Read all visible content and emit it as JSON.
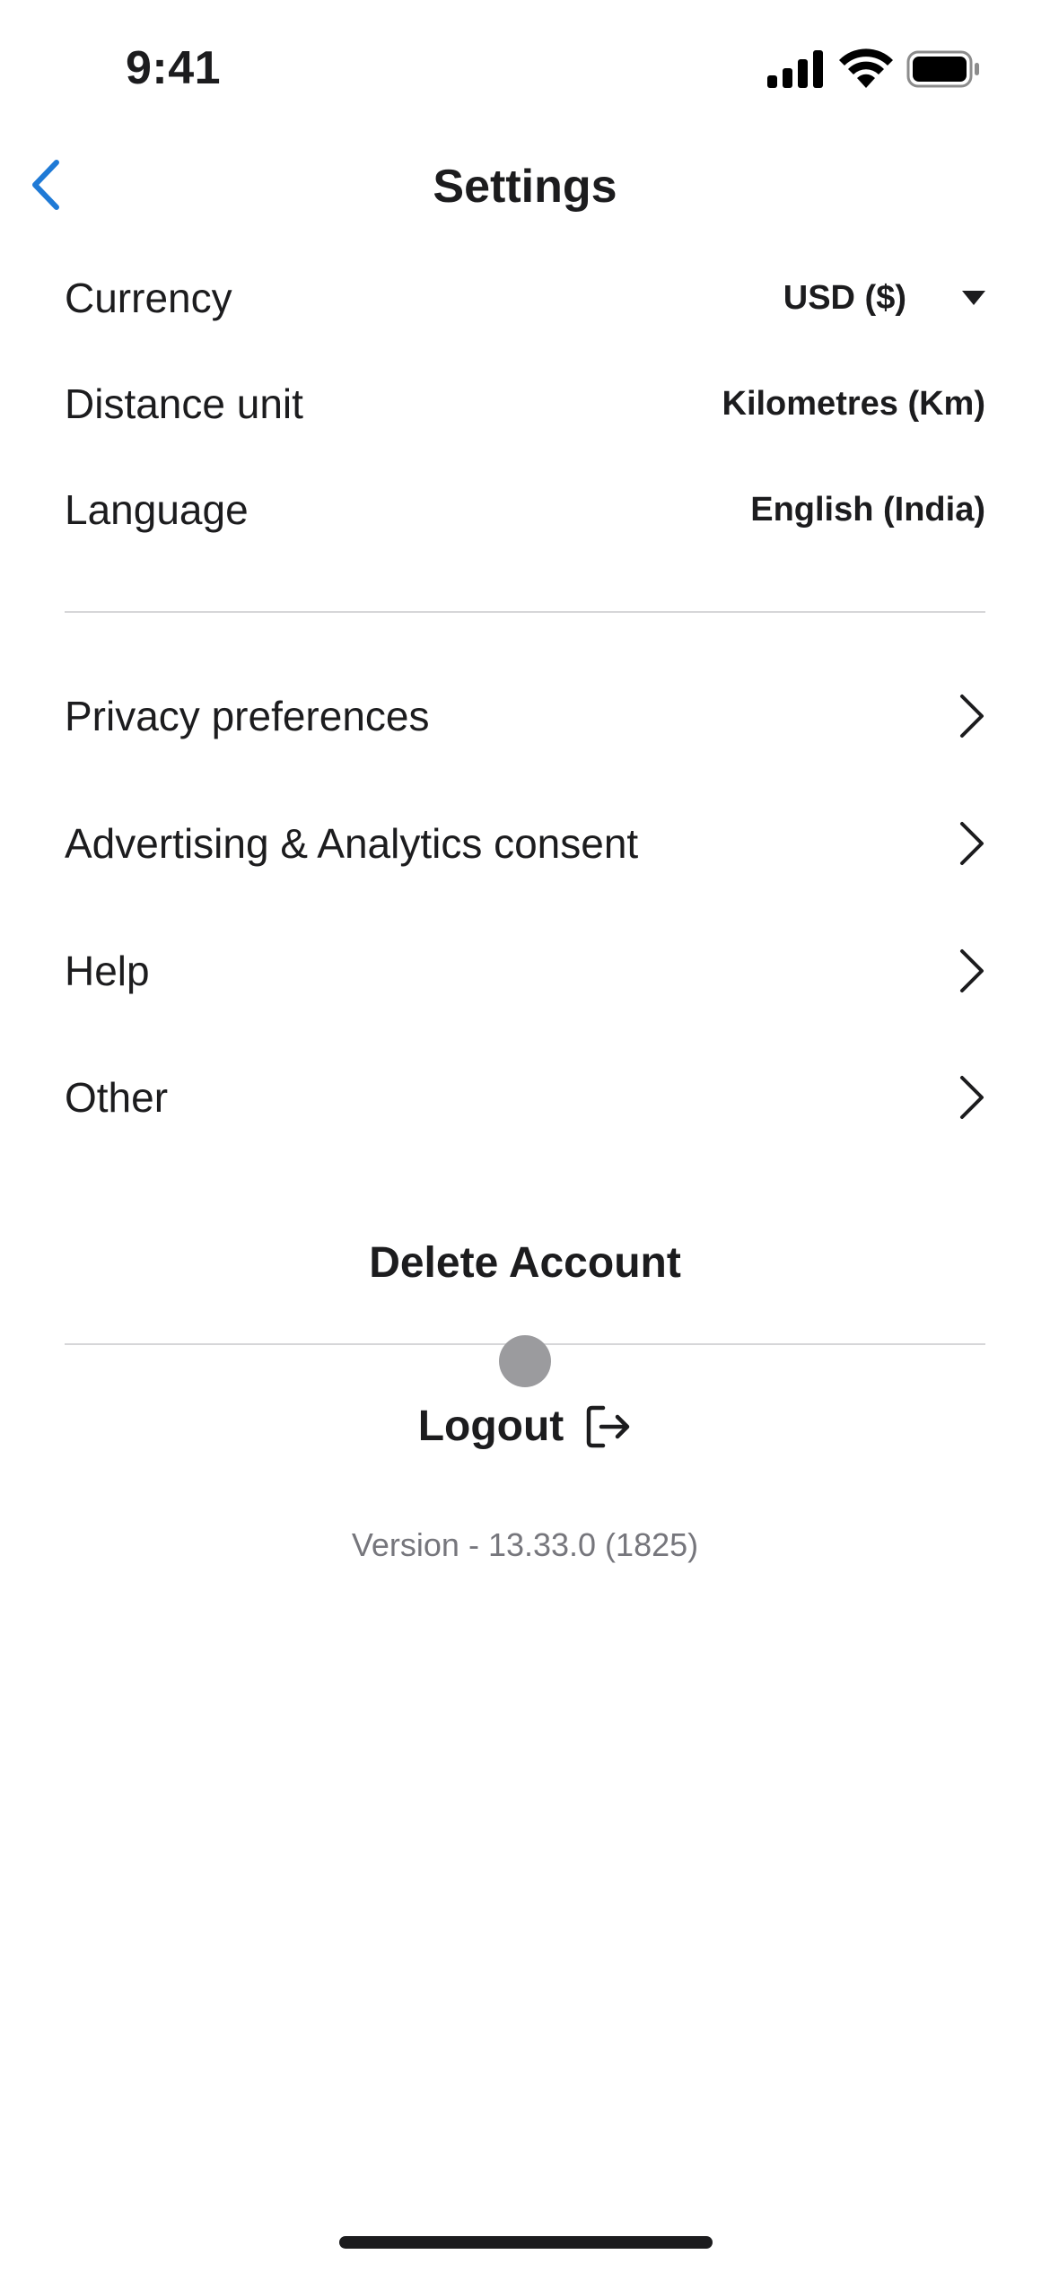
{
  "status_bar": {
    "time": "9:41"
  },
  "header": {
    "title": "Settings",
    "back_icon": "chevron-left-icon",
    "accent_color": "#1f7ad6"
  },
  "preferences": [
    {
      "label": "Currency",
      "value": "USD ($)",
      "has_dropdown": true
    },
    {
      "label": "Distance unit",
      "value": "Kilometres (Km)"
    },
    {
      "label": "Language",
      "value": "English (India)"
    }
  ],
  "menu_items": [
    {
      "label": "Privacy preferences",
      "icon": "chevron-right-icon"
    },
    {
      "label": "Advertising & Analytics consent",
      "icon": "chevron-right-icon"
    },
    {
      "label": "Help",
      "icon": "chevron-right-icon"
    },
    {
      "label": "Other",
      "icon": "chevron-right-icon"
    }
  ],
  "actions": {
    "delete_account": "Delete Account",
    "logout": "Logout",
    "logout_icon": "logout-icon"
  },
  "footer": {
    "version": "Version - 13.33.0 (1825)"
  }
}
